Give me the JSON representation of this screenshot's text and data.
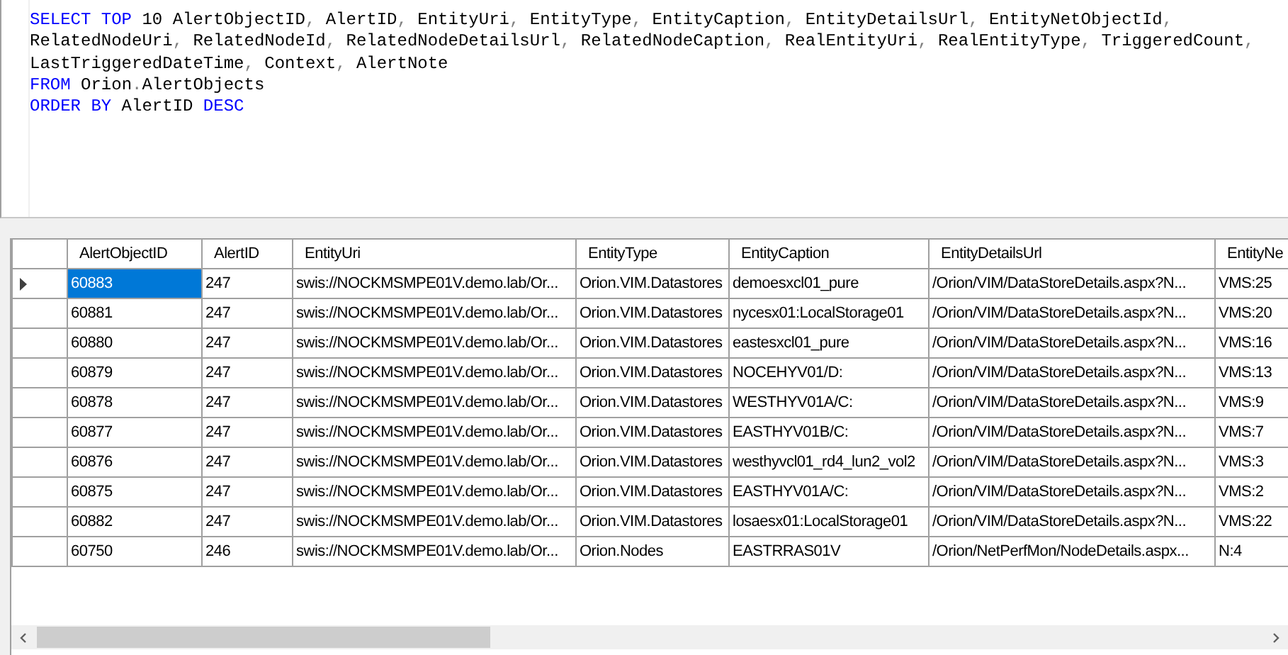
{
  "query": {
    "lines": [
      [
        {
          "kind": "keyword",
          "text": "SELECT TOP"
        },
        {
          "kind": "ident",
          "text": " 10 AlertObjectID"
        },
        {
          "kind": "punct",
          "text": ","
        },
        {
          "kind": "ident",
          "text": " AlertID"
        },
        {
          "kind": "punct",
          "text": ","
        },
        {
          "kind": "ident",
          "text": " EntityUri"
        },
        {
          "kind": "punct",
          "text": ","
        },
        {
          "kind": "ident",
          "text": " EntityType"
        },
        {
          "kind": "punct",
          "text": ","
        },
        {
          "kind": "ident",
          "text": " EntityCaption"
        },
        {
          "kind": "punct",
          "text": ","
        },
        {
          "kind": "ident",
          "text": " EntityDetailsUrl"
        },
        {
          "kind": "punct",
          "text": ","
        },
        {
          "kind": "ident",
          "text": " EntityNetObjectId"
        },
        {
          "kind": "punct",
          "text": ","
        }
      ],
      [
        {
          "kind": "ident",
          "text": "RelatedNodeUri"
        },
        {
          "kind": "punct",
          "text": ","
        },
        {
          "kind": "ident",
          "text": " RelatedNodeId"
        },
        {
          "kind": "punct",
          "text": ","
        },
        {
          "kind": "ident",
          "text": " RelatedNodeDetailsUrl"
        },
        {
          "kind": "punct",
          "text": ","
        },
        {
          "kind": "ident",
          "text": " RelatedNodeCaption"
        },
        {
          "kind": "punct",
          "text": ","
        },
        {
          "kind": "ident",
          "text": " RealEntityUri"
        },
        {
          "kind": "punct",
          "text": ","
        },
        {
          "kind": "ident",
          "text": " RealEntityType"
        },
        {
          "kind": "punct",
          "text": ","
        },
        {
          "kind": "ident",
          "text": " TriggeredCount"
        },
        {
          "kind": "punct",
          "text": ","
        }
      ],
      [
        {
          "kind": "ident",
          "text": "LastTriggeredDateTime"
        },
        {
          "kind": "punct",
          "text": ","
        },
        {
          "kind": "ident",
          "text": " Context"
        },
        {
          "kind": "punct",
          "text": ","
        },
        {
          "kind": "ident",
          "text": " AlertNote"
        }
      ],
      [
        {
          "kind": "keyword",
          "text": "FROM"
        },
        {
          "kind": "ident",
          "text": " Orion"
        },
        {
          "kind": "punct",
          "text": "."
        },
        {
          "kind": "ident",
          "text": "AlertObjects"
        }
      ],
      [
        {
          "kind": "keyword",
          "text": "ORDER BY"
        },
        {
          "kind": "ident",
          "text": " AlertID "
        },
        {
          "kind": "keyword",
          "text": "DESC"
        }
      ]
    ]
  },
  "results": {
    "columns": [
      "AlertObjectID",
      "AlertID",
      "EntityUri",
      "EntityType",
      "EntityCaption",
      "EntityDetailsUrl",
      "EntityNe"
    ],
    "rows": [
      {
        "selected": true,
        "cells": [
          "60883",
          "247",
          "swis://NOCKMSMPE01V.demo.lab/Or...",
          "Orion.VIM.Datastores",
          "demoesxcl01_pure",
          "/Orion/VIM/DataStoreDetails.aspx?N...",
          "VMS:25"
        ]
      },
      {
        "selected": false,
        "cells": [
          "60881",
          "247",
          "swis://NOCKMSMPE01V.demo.lab/Or...",
          "Orion.VIM.Datastores",
          "nycesx01:LocalStorage01",
          "/Orion/VIM/DataStoreDetails.aspx?N...",
          "VMS:20"
        ]
      },
      {
        "selected": false,
        "cells": [
          "60880",
          "247",
          "swis://NOCKMSMPE01V.demo.lab/Or...",
          "Orion.VIM.Datastores",
          "eastesxcl01_pure",
          "/Orion/VIM/DataStoreDetails.aspx?N...",
          "VMS:16"
        ]
      },
      {
        "selected": false,
        "cells": [
          "60879",
          "247",
          "swis://NOCKMSMPE01V.demo.lab/Or...",
          "Orion.VIM.Datastores",
          "NOCEHYV01/D:",
          "/Orion/VIM/DataStoreDetails.aspx?N...",
          "VMS:13"
        ]
      },
      {
        "selected": false,
        "cells": [
          "60878",
          "247",
          "swis://NOCKMSMPE01V.demo.lab/Or...",
          "Orion.VIM.Datastores",
          "WESTHYV01A/C:",
          "/Orion/VIM/DataStoreDetails.aspx?N...",
          "VMS:9"
        ]
      },
      {
        "selected": false,
        "cells": [
          "60877",
          "247",
          "swis://NOCKMSMPE01V.demo.lab/Or...",
          "Orion.VIM.Datastores",
          "EASTHYV01B/C:",
          "/Orion/VIM/DataStoreDetails.aspx?N...",
          "VMS:7"
        ]
      },
      {
        "selected": false,
        "cells": [
          "60876",
          "247",
          "swis://NOCKMSMPE01V.demo.lab/Or...",
          "Orion.VIM.Datastores",
          "westhyvcl01_rd4_lun2_vol2",
          "/Orion/VIM/DataStoreDetails.aspx?N...",
          "VMS:3"
        ]
      },
      {
        "selected": false,
        "cells": [
          "60875",
          "247",
          "swis://NOCKMSMPE01V.demo.lab/Or...",
          "Orion.VIM.Datastores",
          "EASTHYV01A/C:",
          "/Orion/VIM/DataStoreDetails.aspx?N...",
          "VMS:2"
        ]
      },
      {
        "selected": false,
        "cells": [
          "60882",
          "247",
          "swis://NOCKMSMPE01V.demo.lab/Or...",
          "Orion.VIM.Datastores",
          "losaesx01:LocalStorage01",
          "/Orion/VIM/DataStoreDetails.aspx?N...",
          "VMS:22"
        ]
      },
      {
        "selected": false,
        "cells": [
          "60750",
          "246",
          "swis://NOCKMSMPE01V.demo.lab/Or...",
          "Orion.Nodes",
          "EASTRRAS01V",
          "/Orion/NetPerfMon/NodeDetails.aspx...",
          "N:4"
        ]
      }
    ]
  }
}
